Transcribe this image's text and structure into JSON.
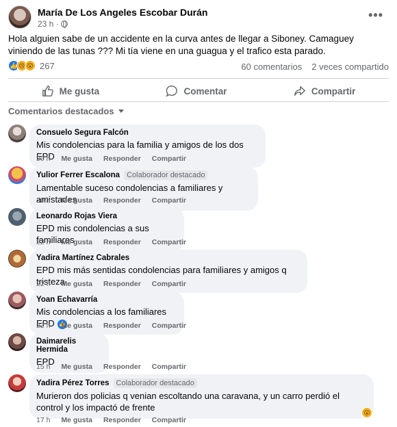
{
  "post": {
    "author": "María De Los Angeles Escobar Durán",
    "time": "23 h ·",
    "text": "Hola alguien sabe de un accidente en la curva  antes de llegar a Siboney. Camaguey  viniendo de las tunas ??? Mi tía viene en una guagua y el trafico esta parado.",
    "reaction_count": "267",
    "comments_count": "60 comentarios",
    "shares_count": "2 veces compartido"
  },
  "actions": {
    "like": "Me gusta",
    "comment": "Comentar",
    "share": "Compartir"
  },
  "sort_label": "Comentarios destacados",
  "comment_actions": {
    "like": "Me gusta",
    "reply": "Responder",
    "share": "Compartir"
  },
  "comments": [
    {
      "name": "Consuelo Segura Falcón",
      "badge": "",
      "text": "Mis condolencias para la familia y amigos de los dos EPD",
      "time": "20 h",
      "avatar_color": "#8a7f7a"
    },
    {
      "name": "Yulior Ferrer Escalona",
      "badge": "Colaborador destacado",
      "text": "Lamentable suceso condolencias a familiares y amistades",
      "time": "20 h",
      "avatar_color": "#e0b84a"
    },
    {
      "name": "Leonardo Rojas Viera",
      "badge": "",
      "text": "EPD mis condolencias a sus familiares",
      "time": "22 h",
      "avatar_color": "#4f5f6e"
    },
    {
      "name": "Yadira Martínez Cabrales",
      "badge": "",
      "text": "EPD mis más sentidas condolencias para familiares y amigos q tristeza",
      "time": "22 h",
      "avatar_color": "#b06a3a"
    },
    {
      "name": "Yoan Echavarría",
      "badge": "",
      "text": "Mis condolencias a los familiares EPD",
      "time": "22 h",
      "avatar_color": "#9c5a60"
    },
    {
      "name": "Daimarelis Hermida",
      "badge": "",
      "text": "EPD",
      "time": "15 h",
      "avatar_color": "#6d4a44"
    },
    {
      "name": "Yadira Pérez Torres",
      "badge": "Colaborador destacado",
      "text": "Murieron dos policias q venian escoltando una caravana, y un carro perdió el control y los impactó de frente",
      "time": "17 h",
      "avatar_color": "#c43b3b"
    }
  ],
  "colors": {
    "like_blue": "#1877f2",
    "bubble_bg": "#f0f2f5",
    "muted_text": "#65676b"
  }
}
